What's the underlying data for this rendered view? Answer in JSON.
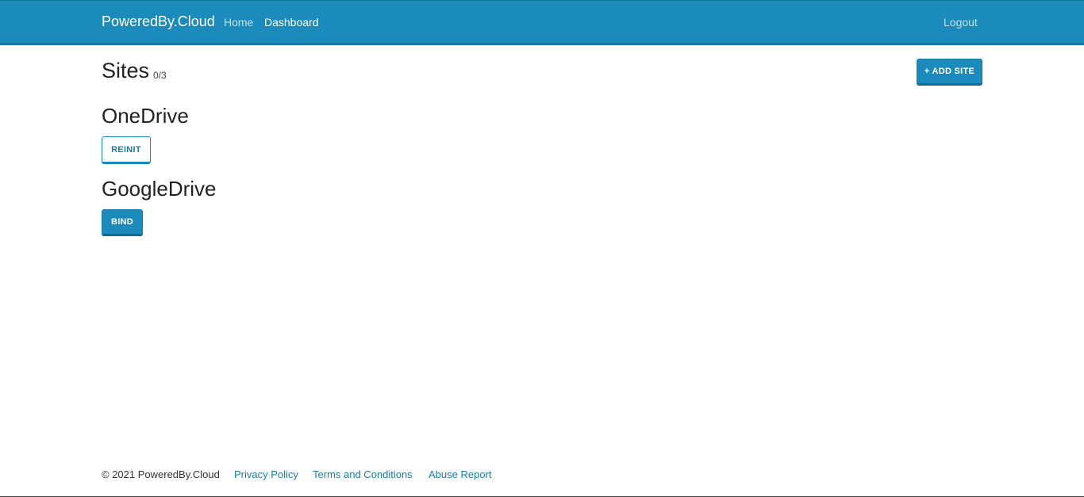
{
  "navbar": {
    "brand": "PoweredBy.Cloud",
    "links": {
      "home": "Home",
      "dashboard": "Dashboard"
    },
    "logout": "Logout",
    "colors": {
      "background": "#1a8bbb",
      "active_link": "#ffffff",
      "inactive_link": "#bfe0ee"
    }
  },
  "header": {
    "title": "Sites",
    "count": "0/3",
    "add_button": "+ ADD SITE"
  },
  "sites": [
    {
      "name": "OneDrive",
      "action": "REINIT",
      "action_style": "outline"
    },
    {
      "name": "GoogleDrive",
      "action": "BIND",
      "action_style": "primary"
    }
  ],
  "footer": {
    "copyright": "© 2021 PoweredBy.Cloud",
    "links": {
      "privacy": "Privacy Policy",
      "terms": "Terms and Conditions",
      "abuse": "Abuse Report"
    },
    "link_color": "#1a7fa8"
  }
}
